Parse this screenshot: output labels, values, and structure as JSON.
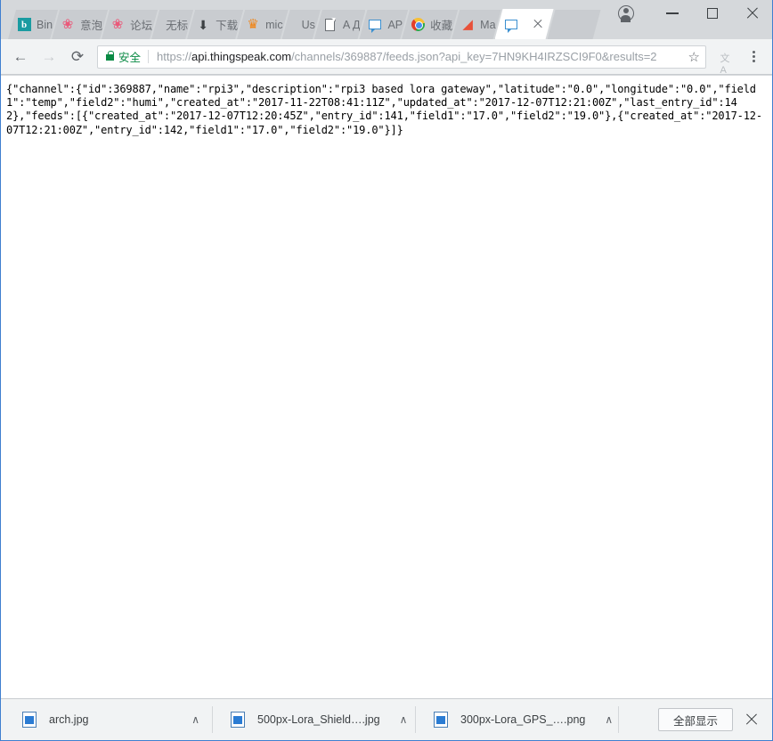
{
  "window": {
    "controls": {
      "avatar": "profile-avatar",
      "minimize": "–",
      "maximize": "",
      "close": ""
    }
  },
  "tabs": [
    {
      "label": "Bin",
      "icon": "bing-icon",
      "glyph": "b",
      "active": false
    },
    {
      "label": "意泡",
      "icon": "flower-icon",
      "glyph": "❀",
      "active": false
    },
    {
      "label": "论坛",
      "icon": "flower-icon",
      "glyph": "❀",
      "active": false
    },
    {
      "label": "无标",
      "icon": "blank-icon",
      "glyph": "",
      "active": false
    },
    {
      "label": "下载",
      "icon": "download-icon",
      "glyph": "⬇",
      "active": false
    },
    {
      "label": "mic",
      "icon": "crab-icon",
      "glyph": "♛",
      "active": false
    },
    {
      "label": "Us",
      "icon": "blank-icon",
      "glyph": "",
      "active": false
    },
    {
      "label": "A Д",
      "icon": "page-icon",
      "glyph": "",
      "active": false
    },
    {
      "label": "AP",
      "icon": "bubble-icon",
      "glyph": "",
      "active": false
    },
    {
      "label": "收藏",
      "icon": "chrome-icon",
      "glyph": "",
      "active": false
    },
    {
      "label": "Ma",
      "icon": "matlab-icon",
      "glyph": "◢",
      "active": false
    },
    {
      "label": "",
      "icon": "bubble-icon",
      "glyph": "",
      "active": true
    }
  ],
  "toolbar": {
    "back": "←",
    "forward": "→",
    "reload": "⟳",
    "star": "☆",
    "translate": "文A",
    "menu": "kebab-menu"
  },
  "omnibox": {
    "security_label": "安全",
    "url_scheme": "https://",
    "url_host": "api.thingspeak.com",
    "url_path": "/channels/369887/feeds.json?api_key=7HN9KH4IRZSCI9F0&results=2"
  },
  "page": {
    "json_text": "{\"channel\":{\"id\":369887,\"name\":\"rpi3\",\"description\":\"rpi3 based lora gateway\",\"latitude\":\"0.0\",\"longitude\":\"0.0\",\"field1\":\"temp\",\"field2\":\"humi\",\"created_at\":\"2017-11-22T08:41:11Z\",\"updated_at\":\"2017-12-07T12:21:00Z\",\"last_entry_id\":142},\"feeds\":[{\"created_at\":\"2017-12-07T12:20:45Z\",\"entry_id\":141,\"field1\":\"17.0\",\"field2\":\"19.0\"},{\"created_at\":\"2017-12-07T12:21:00Z\",\"entry_id\":142,\"field1\":\"17.0\",\"field2\":\"19.0\"}]}"
  },
  "downloads": {
    "items": [
      {
        "name": "arch.jpg",
        "chevron": "∧"
      },
      {
        "name": "500px-Lora_Shield….jpg",
        "chevron": "∧"
      },
      {
        "name": "300px-Lora_GPS_….png",
        "chevron": "∧"
      }
    ],
    "show_all_label": "全部显示"
  },
  "colors": {
    "accent_blue": "#3a8fd0",
    "secure_green": "#0a8a44",
    "tab_inactive": "#c9ccd0",
    "tab_active": "#ffffff",
    "toolbar_bg": "#f1f3f4",
    "window_border": "#3f7fd0"
  }
}
